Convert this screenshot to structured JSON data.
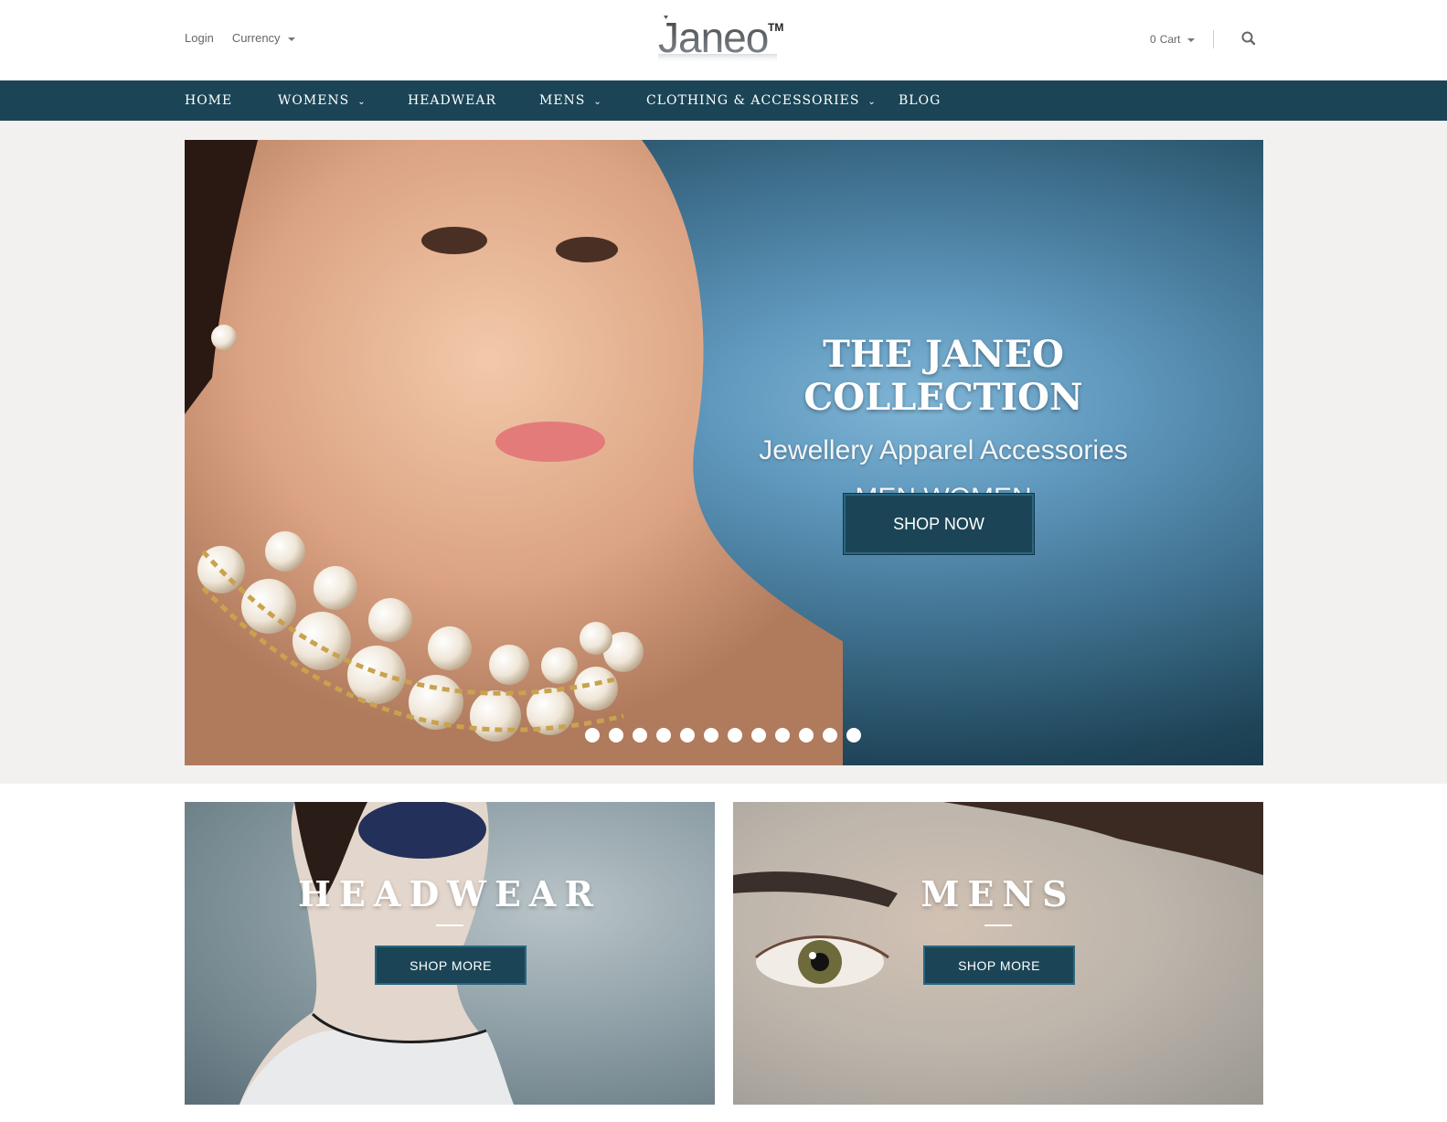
{
  "header": {
    "login_label": "Login",
    "currency_label": "Currency",
    "logo_text": "Janeo",
    "logo_tm": "TM",
    "cart_count": "0",
    "cart_label": "Cart"
  },
  "nav": {
    "items": [
      {
        "label": "HOME",
        "has_dropdown": false
      },
      {
        "label": "WOMENS",
        "has_dropdown": true
      },
      {
        "label": "HEADWEAR",
        "has_dropdown": false
      },
      {
        "label": "MENS",
        "has_dropdown": true
      },
      {
        "label": "CLOTHING & ACCESSORIES",
        "has_dropdown": true
      },
      {
        "label": "BLOG",
        "has_dropdown": false
      }
    ]
  },
  "hero": {
    "title": "THE JANEO COLLECTION",
    "subtitle_1": "Jewellery Apparel Accessories",
    "subtitle_2": "MEN WOMEN",
    "button_label": "SHOP NOW",
    "slide_count": 12
  },
  "banners": [
    {
      "title": "HEADWEAR",
      "button_label": "SHOP MORE"
    },
    {
      "title": "MENS",
      "button_label": "SHOP MORE"
    }
  ],
  "colors": {
    "nav_background": "#1b4556",
    "button_background": "#1b4556",
    "hero_band": "#f2f1ef"
  }
}
